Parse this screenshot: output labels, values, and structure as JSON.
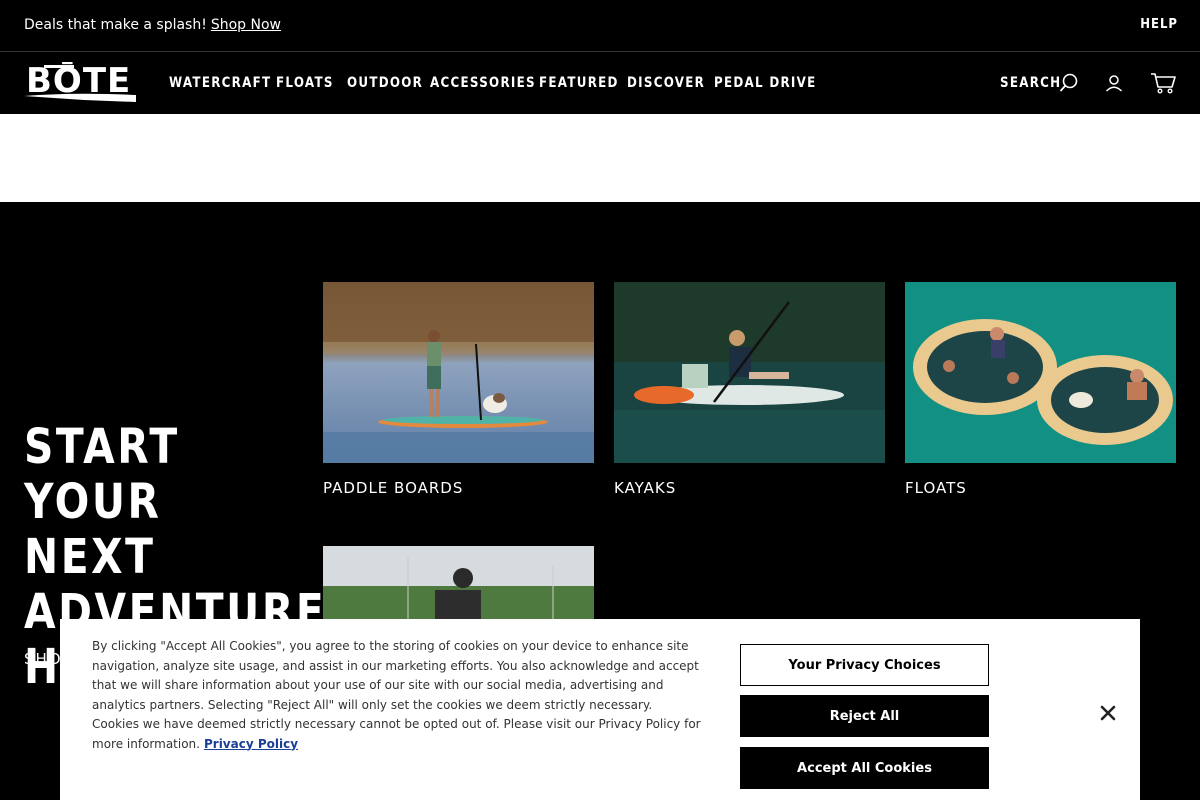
{
  "promo": {
    "text": "Deals that make a splash!",
    "link": "Shop Now"
  },
  "help": "HELP",
  "brand": {
    "logo": "BŌTE"
  },
  "nav": [
    "WATERCRAFT",
    "FLOATS",
    "OUTDOOR",
    "ACCESSORIES",
    "FEATURED",
    "DISCOVER",
    "PEDAL DRIVE"
  ],
  "search_label": "SEARCH",
  "icons": {
    "search": "search-icon",
    "account": "user-icon",
    "cart": "cart-icon",
    "close": "close-icon"
  },
  "hero": {
    "headline": "START YOUR NEXT ADVENTURE HERE",
    "shop_link": "SHOP"
  },
  "categories": [
    {
      "label": "PADDLE BOARDS"
    },
    {
      "label": "KAYAKS"
    },
    {
      "label": "FLOATS"
    },
    {
      "label": ""
    }
  ],
  "cookie": {
    "text": "By clicking \"Accept All Cookies\", you agree to the storing of cookies on your device to enhance site navigation, analyze site usage, and assist in our marketing efforts. You also acknowledge and accept that we will share information about your use of our site with our social media, advertising and analytics partners. Selecting \"Reject All\" will only set the cookies we deem strictly necessary. Cookies we have deemed strictly necessary cannot be opted out of. Please visit our Privacy Policy for more information.",
    "policy_link": "Privacy Policy",
    "btn_choices": "Your Privacy Choices",
    "btn_reject": "Reject All",
    "btn_accept": "Accept All Cookies"
  },
  "colors": {
    "bg_dark": "#000000",
    "link_blue": "#1b3f96"
  }
}
